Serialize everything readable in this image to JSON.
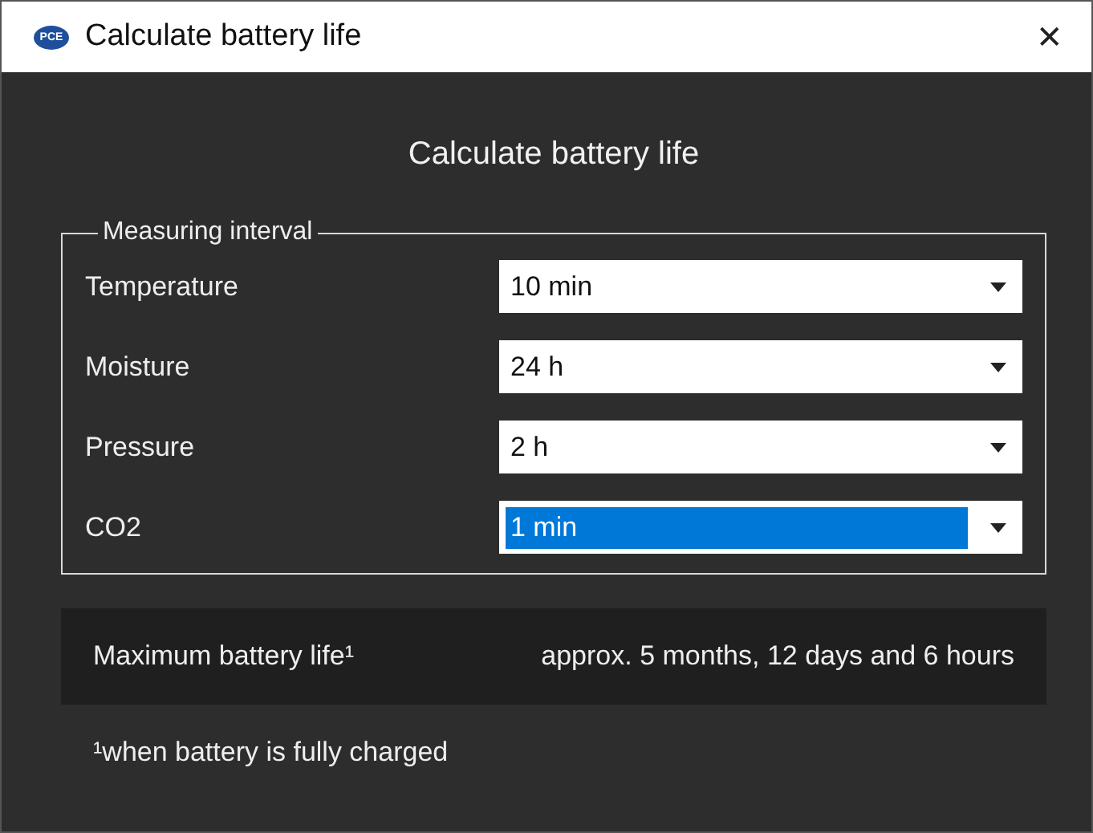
{
  "window": {
    "logo": "PCE",
    "title": "Calculate battery life",
    "close": "✕"
  },
  "heading": "Calculate battery life",
  "group": {
    "legend": "Measuring interval",
    "rows": [
      {
        "label": "Temperature",
        "value": "10 min",
        "focused": false
      },
      {
        "label": "Moisture",
        "value": "24 h",
        "focused": false
      },
      {
        "label": "Pressure",
        "value": "2 h",
        "focused": false
      },
      {
        "label": "CO2",
        "value": "1 min",
        "focused": true
      }
    ]
  },
  "result": {
    "label": "Maximum battery life¹",
    "value": "approx. 5 months, 12 days and 6 hours"
  },
  "footnote": "¹when battery is fully charged"
}
